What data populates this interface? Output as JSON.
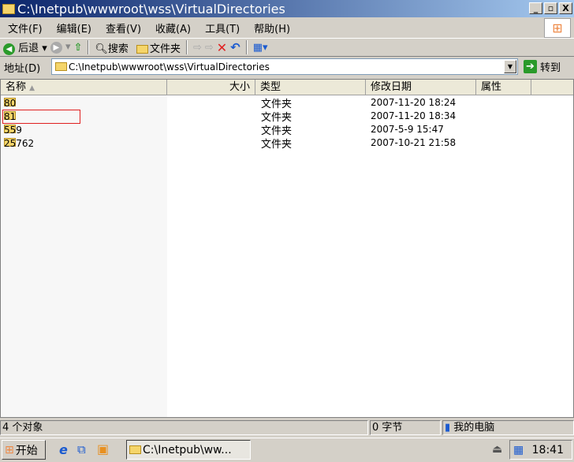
{
  "window": {
    "title": "C:\\Inetpub\\wwwroot\\wss\\VirtualDirectories",
    "minimize": "_",
    "restore": "▫",
    "close": "X"
  },
  "menu": [
    "文件(F)",
    "编辑(E)",
    "查看(V)",
    "收藏(A)",
    "工具(T)",
    "帮助(H)"
  ],
  "toolbar": {
    "back": "后退",
    "search": "搜索",
    "folders": "文件夹"
  },
  "address": {
    "label": "地址(D)",
    "value": "C:\\Inetpub\\wwwroot\\wss\\VirtualDirectories",
    "go": "转到"
  },
  "columns": {
    "name": "名称",
    "size": "大小",
    "type": "类型",
    "modified": "修改日期",
    "attributes": "属性"
  },
  "files": [
    {
      "name": "80",
      "type": "文件夹",
      "modified": "2007-11-20 18:24"
    },
    {
      "name": "81",
      "type": "文件夹",
      "modified": "2007-11-20 18:34"
    },
    {
      "name": "559",
      "type": "文件夹",
      "modified": "2007-5-9 15:47"
    },
    {
      "name": "25762",
      "type": "文件夹",
      "modified": "2007-10-21 21:58"
    }
  ],
  "status": {
    "objects": "4 个对象",
    "bytes": "0 字节",
    "location": "我的电脑"
  },
  "taskbar": {
    "start": "开始",
    "task": "C:\\Inetpub\\ww...",
    "clock": "18:41"
  }
}
